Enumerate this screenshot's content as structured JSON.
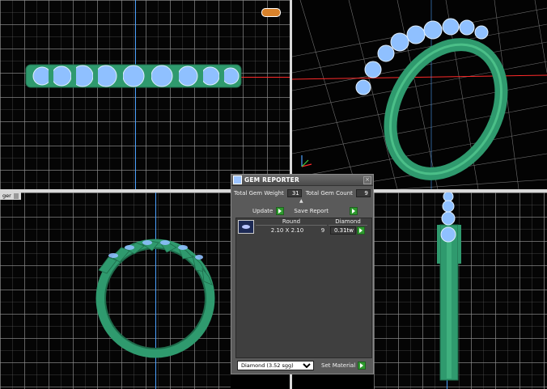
{
  "gem_reporter": {
    "title": "GEM REPORTER",
    "close_glyph": "×",
    "total_gem_weight_label": "Total Gem Weight",
    "total_gem_weight_value": "31",
    "total_gem_count_label": "Total Gem Count",
    "total_gem_count_value": "9",
    "update_label": "Update",
    "save_report_label": "Save Report",
    "collapse_glyph": "▲",
    "table": {
      "col_shape": "Round",
      "col_material": "Diamond",
      "rows": [
        {
          "size": "2.10 X 2.10",
          "count": "9",
          "weight": "0.31tw"
        }
      ]
    },
    "material_select": "Diamond    (3.52 sgg)",
    "set_material_label": "Set Material"
  },
  "viewport_label_left": "ger",
  "colors": {
    "metal": "#2f9a6e",
    "gem": "#7fb5ff",
    "axis_x": "#ff2a2a",
    "axis_y": "#4da3ff",
    "button_green": "#2e9a2e"
  },
  "icons": [
    "gem-reporter-icon",
    "close-icon",
    "play-icon",
    "collapse-arrow-icon",
    "gem-thumbnail-icon",
    "dropdown-arrow-icon",
    "logo-badge"
  ]
}
